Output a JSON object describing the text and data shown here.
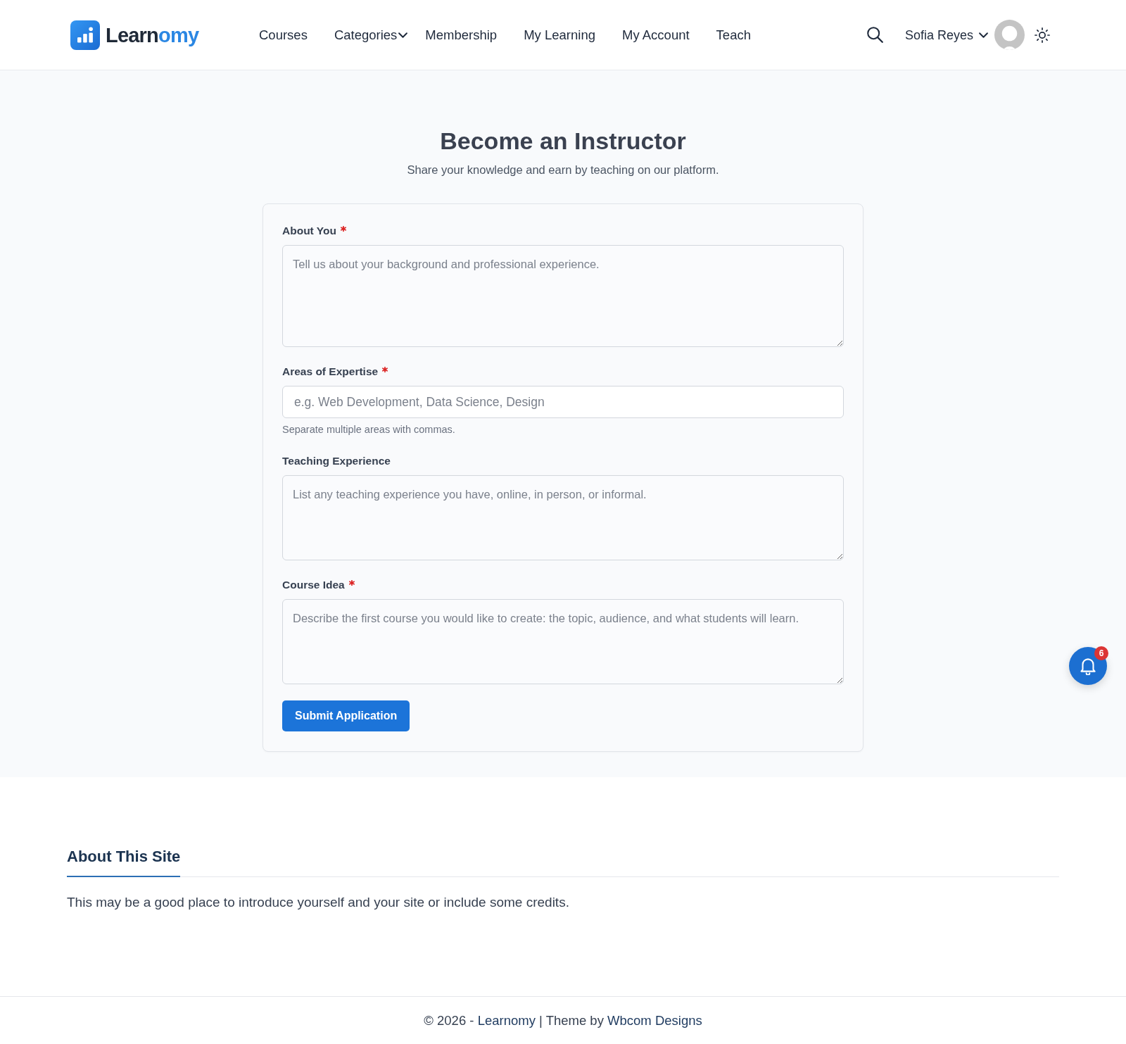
{
  "header": {
    "logo": {
      "parts": [
        "Learn",
        "omy"
      ]
    },
    "nav": [
      {
        "label": "Courses",
        "dropdown": false
      },
      {
        "label": "Categories",
        "dropdown": true
      },
      {
        "label": "Membership",
        "dropdown": false
      },
      {
        "label": "My Learning",
        "dropdown": false
      },
      {
        "label": "My Account",
        "dropdown": false
      },
      {
        "label": "Teach",
        "dropdown": false
      }
    ],
    "user": {
      "name": "Sofia Reyes"
    }
  },
  "intro": {
    "title": "Become an Instructor",
    "subtitle": "Share your knowledge and earn by teaching on our platform."
  },
  "form": {
    "fields": [
      {
        "kind": "textarea",
        "label": "About You",
        "required": true,
        "placeholder": "Tell us about your background and professional experience."
      },
      {
        "kind": "input",
        "label": "Areas of Expertise",
        "required": true,
        "placeholder": "e.g. Web Development, Data Science, Design",
        "help": "Separate multiple areas with commas."
      },
      {
        "kind": "textarea",
        "label": "Teaching Experience",
        "required": false,
        "placeholder": "List any teaching experience you have, online, in person, or informal."
      },
      {
        "kind": "textarea",
        "label": "Course Idea",
        "required": true,
        "placeholder": "Describe the first course you would like to create: the topic, audience, and what students will learn."
      }
    ],
    "submit": "Submit Application"
  },
  "notifications": {
    "count": "6"
  },
  "widget": {
    "title": "About This Site",
    "text": "This may be a good place to introduce yourself and your site or include some credits."
  },
  "footer": {
    "prefix": "© 2026 -",
    "site_link": "Learnomy",
    "separator": "|",
    "theme_prefix": "Theme by",
    "theme_link": "Wbcom Designs"
  }
}
